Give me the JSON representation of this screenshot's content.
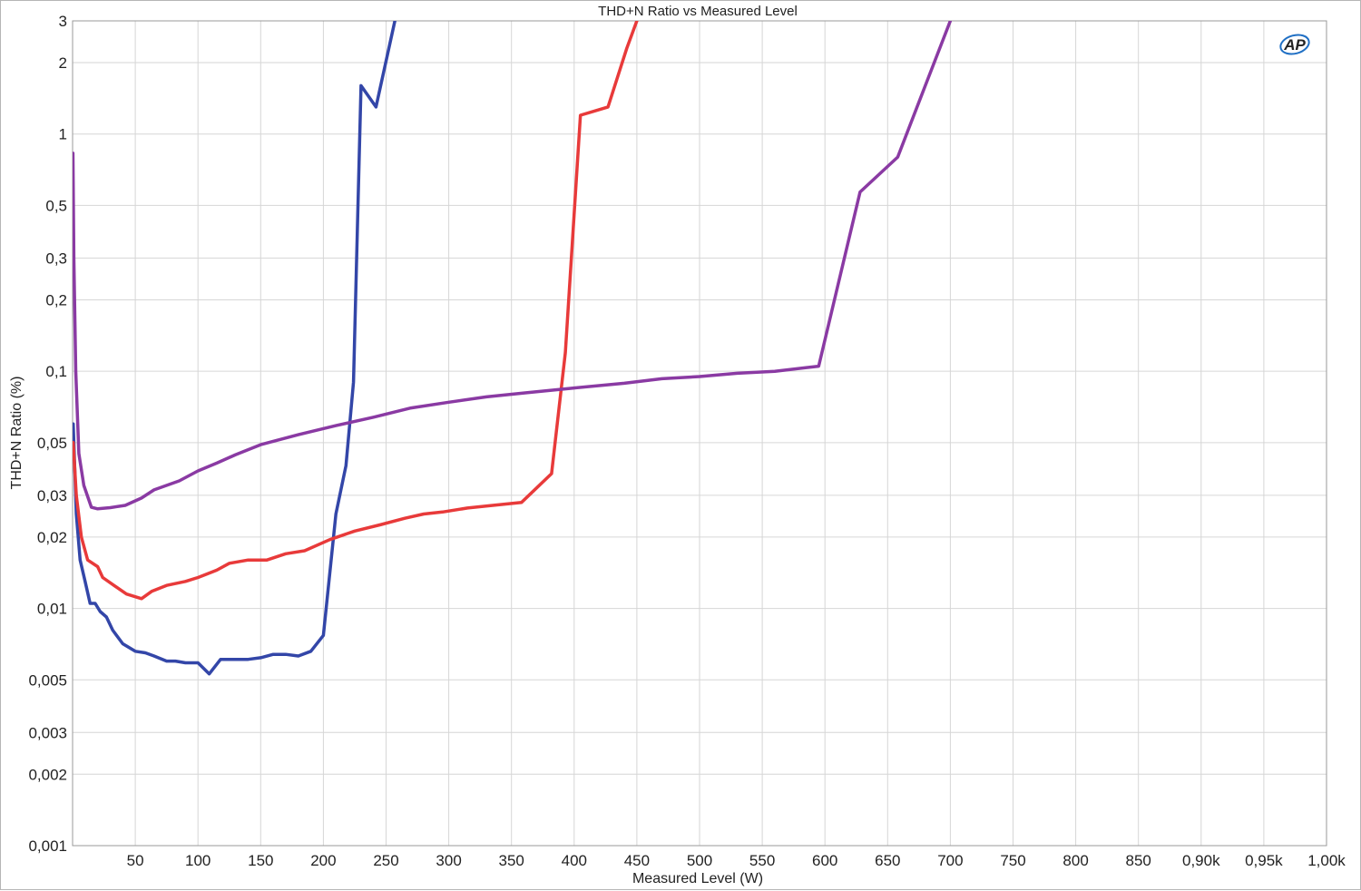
{
  "chart_data": {
    "type": "line",
    "title": "THD+N Ratio vs Measured Level",
    "xlabel": "Measured Level (W)",
    "ylabel": "THD+N Ratio (%)",
    "xlim": [
      0,
      1000
    ],
    "ylim": [
      0.001,
      3
    ],
    "yscale": "log",
    "grid": true,
    "x_ticks": [
      {
        "value": 50,
        "label": "50"
      },
      {
        "value": 100,
        "label": "100"
      },
      {
        "value": 150,
        "label": "150"
      },
      {
        "value": 200,
        "label": "200"
      },
      {
        "value": 250,
        "label": "250"
      },
      {
        "value": 300,
        "label": "300"
      },
      {
        "value": 350,
        "label": "350"
      },
      {
        "value": 400,
        "label": "400"
      },
      {
        "value": 450,
        "label": "450"
      },
      {
        "value": 500,
        "label": "500"
      },
      {
        "value": 550,
        "label": "550"
      },
      {
        "value": 600,
        "label": "600"
      },
      {
        "value": 650,
        "label": "650"
      },
      {
        "value": 700,
        "label": "700"
      },
      {
        "value": 750,
        "label": "750"
      },
      {
        "value": 800,
        "label": "800"
      },
      {
        "value": 850,
        "label": "850"
      },
      {
        "value": 900,
        "label": "0,90k"
      },
      {
        "value": 950,
        "label": "0,95k"
      },
      {
        "value": 1000,
        "label": "1,00k"
      }
    ],
    "y_ticks": [
      {
        "value": 3,
        "label": "3"
      },
      {
        "value": 2,
        "label": "2"
      },
      {
        "value": 1,
        "label": "1"
      },
      {
        "value": 0.5,
        "label": "0,5"
      },
      {
        "value": 0.3,
        "label": "0,3"
      },
      {
        "value": 0.2,
        "label": "0,2"
      },
      {
        "value": 0.1,
        "label": "0,1"
      },
      {
        "value": 0.05,
        "label": "0,05"
      },
      {
        "value": 0.03,
        "label": "0,03"
      },
      {
        "value": 0.02,
        "label": "0,02"
      },
      {
        "value": 0.01,
        "label": "0,01"
      },
      {
        "value": 0.005,
        "label": "0,005"
      },
      {
        "value": 0.003,
        "label": "0,003"
      },
      {
        "value": 0.002,
        "label": "0,002"
      },
      {
        "value": 0.001,
        "label": "0,001"
      }
    ],
    "series": [
      {
        "color": "#3346a8",
        "points": [
          [
            0.5,
            0.06
          ],
          [
            3,
            0.025
          ],
          [
            6,
            0.016
          ],
          [
            10,
            0.013
          ],
          [
            14,
            0.0105
          ],
          [
            18,
            0.0105
          ],
          [
            22,
            0.0097
          ],
          [
            27,
            0.0092
          ],
          [
            32,
            0.0081
          ],
          [
            40,
            0.0071
          ],
          [
            50,
            0.0066
          ],
          [
            58,
            0.0065
          ],
          [
            65,
            0.0063
          ],
          [
            75,
            0.006
          ],
          [
            82,
            0.006
          ],
          [
            90,
            0.0059
          ],
          [
            100,
            0.0059
          ],
          [
            109,
            0.0053
          ],
          [
            118,
            0.0061
          ],
          [
            128,
            0.0061
          ],
          [
            140,
            0.0061
          ],
          [
            150,
            0.0062
          ],
          [
            160,
            0.0064
          ],
          [
            170,
            0.0064
          ],
          [
            180,
            0.0063
          ],
          [
            190,
            0.0066
          ],
          [
            200,
            0.0077
          ],
          [
            210,
            0.025
          ],
          [
            218,
            0.04
          ],
          [
            224,
            0.09
          ],
          [
            230,
            1.6
          ],
          [
            242,
            1.3
          ],
          [
            257,
            3.0
          ]
        ]
      },
      {
        "color": "#e83a3a",
        "points": [
          [
            0.5,
            0.05
          ],
          [
            3,
            0.03
          ],
          [
            7,
            0.02
          ],
          [
            12,
            0.016
          ],
          [
            20,
            0.015
          ],
          [
            24,
            0.0135
          ],
          [
            33,
            0.0125
          ],
          [
            43,
            0.0115
          ],
          [
            55,
            0.011
          ],
          [
            63,
            0.0118
          ],
          [
            75,
            0.0125
          ],
          [
            90,
            0.013
          ],
          [
            100,
            0.0135
          ],
          [
            115,
            0.0145
          ],
          [
            125,
            0.0155
          ],
          [
            140,
            0.016
          ],
          [
            155,
            0.016
          ],
          [
            170,
            0.017
          ],
          [
            185,
            0.0175
          ],
          [
            205,
            0.0195
          ],
          [
            225,
            0.0212
          ],
          [
            245,
            0.0225
          ],
          [
            265,
            0.024
          ],
          [
            280,
            0.025
          ],
          [
            295,
            0.0255
          ],
          [
            315,
            0.0265
          ],
          [
            335,
            0.0272
          ],
          [
            358,
            0.028
          ],
          [
            382,
            0.037
          ],
          [
            393,
            0.12
          ],
          [
            405,
            1.2
          ],
          [
            427,
            1.3
          ],
          [
            442,
            2.3
          ],
          [
            450,
            3.0
          ]
        ]
      },
      {
        "color": "#8a3aa3",
        "points": [
          [
            0.3,
            0.83
          ],
          [
            1,
            0.3
          ],
          [
            2.5,
            0.1
          ],
          [
            5,
            0.045
          ],
          [
            9,
            0.033
          ],
          [
            15,
            0.0267
          ],
          [
            20,
            0.0263
          ],
          [
            30,
            0.0266
          ],
          [
            42,
            0.0272
          ],
          [
            55,
            0.0292
          ],
          [
            65,
            0.0316
          ],
          [
            85,
            0.0345
          ],
          [
            100,
            0.038
          ],
          [
            115,
            0.041
          ],
          [
            130,
            0.0445
          ],
          [
            150,
            0.049
          ],
          [
            180,
            0.054
          ],
          [
            210,
            0.059
          ],
          [
            240,
            0.064
          ],
          [
            270,
            0.07
          ],
          [
            300,
            0.074
          ],
          [
            330,
            0.078
          ],
          [
            360,
            0.081
          ],
          [
            400,
            0.085
          ],
          [
            440,
            0.089
          ],
          [
            470,
            0.093
          ],
          [
            500,
            0.095
          ],
          [
            530,
            0.098
          ],
          [
            560,
            0.1
          ],
          [
            595,
            0.105
          ],
          [
            628,
            0.57
          ],
          [
            658,
            0.8
          ],
          [
            680,
            1.6
          ],
          [
            700,
            3.0
          ]
        ]
      }
    ]
  },
  "logo": {
    "text": "AP",
    "color": "#1f6fc4"
  }
}
